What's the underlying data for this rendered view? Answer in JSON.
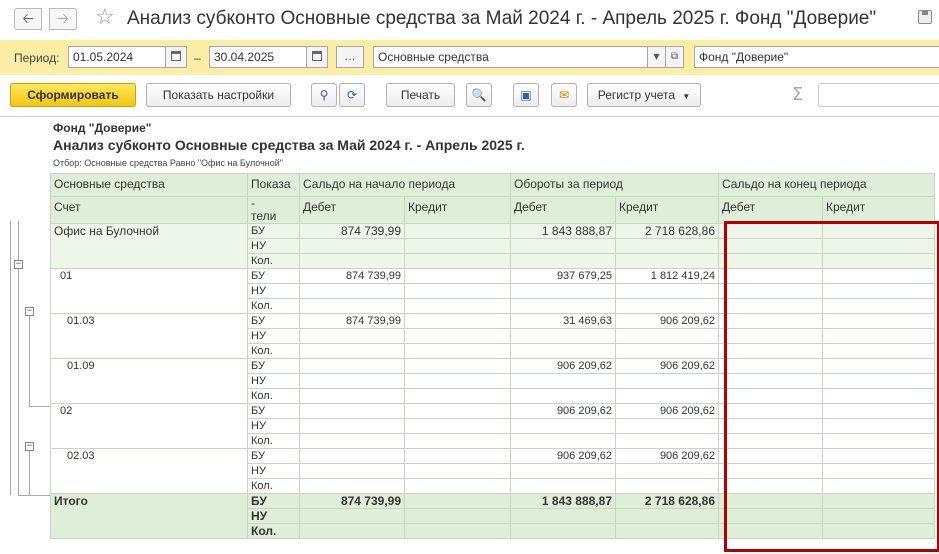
{
  "window": {
    "title": "Анализ субконто Основные средства за Май 2024 г. - Апрель 2025 г. Фонд \"Доверие\"",
    "back_icon": "arrow-left-icon",
    "forward_icon": "arrow-right-icon",
    "favorite_icon": "star-icon"
  },
  "period": {
    "label": "Период:",
    "from": "01.05.2024",
    "dash": "–",
    "to": "30.04.2025",
    "more_label": "...",
    "subconto": "Основные средства",
    "organization": "Фонд \"Доверие\""
  },
  "toolbar": {
    "generate": "Сформировать",
    "settings": "Показать настройки",
    "print": "Печать",
    "register": "Регистр учета"
  },
  "report": {
    "organization": "Фонд \"Доверие\"",
    "title": "Анализ субконто Основные средства за Май 2024 г. - Апрель 2025 г.",
    "filter": "Отбор: Основные средства Равно \"Офис на Булочной\"",
    "headers": {
      "col_fixed_assets": "Основные средства",
      "col_indicator": "Показа",
      "col_indicator_cont": "-",
      "col_indicator_cont2": "тели",
      "col_account": "Счет",
      "opening": "Сальдо на начало периода",
      "turnover": "Обороты за период",
      "closing": "Сальдо на конец периода",
      "debit": "Дебет",
      "credit": "Кредит"
    },
    "indicators": [
      "БУ",
      "НУ",
      "Кол."
    ],
    "rows": [
      {
        "name": "Офис на Булочной",
        "opening_debit": "874 739,99",
        "turn_debit": "1 843 888,87",
        "turn_credit": "2 718 628,86"
      },
      {
        "name": "01",
        "opening_debit": "874 739,99",
        "turn_debit": "937 679,25",
        "turn_credit": "1 812 419,24"
      },
      {
        "name": "01.03",
        "opening_debit": "874 739,99",
        "turn_debit": "31 469,63",
        "turn_credit": "906 209,62"
      },
      {
        "name": "01.09",
        "opening_debit": "",
        "turn_debit": "906 209,62",
        "turn_credit": "906 209,62"
      },
      {
        "name": "02",
        "opening_debit": "",
        "turn_debit": "906 209,62",
        "turn_credit": "906 209,62"
      },
      {
        "name": "02.03",
        "opening_debit": "",
        "turn_debit": "906 209,62",
        "turn_credit": "906 209,62"
      }
    ],
    "total": {
      "name": "Итого",
      "opening_debit": "874 739,99",
      "turn_debit": "1 843 888,87",
      "turn_credit": "2 718 628,86"
    }
  },
  "colors": {
    "period_bar": "#fbeda6",
    "header_bg": "#dfeed8",
    "highlight_border": "#b50000"
  }
}
